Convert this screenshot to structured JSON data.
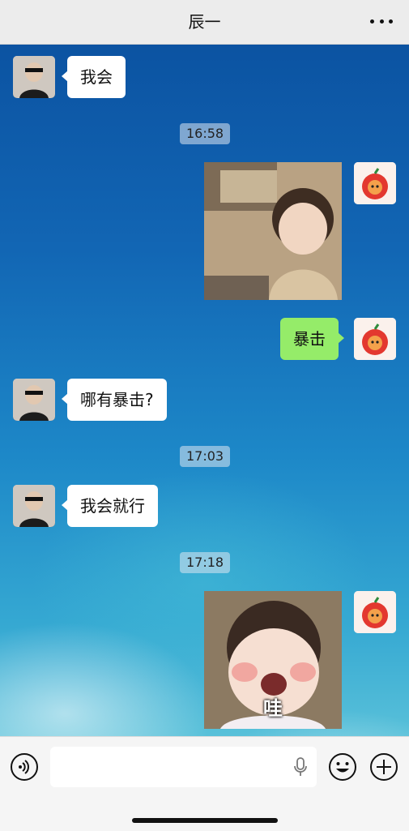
{
  "header": {
    "title": "辰一",
    "more_icon": "more-dots-icon"
  },
  "messages": [
    {
      "side": "left",
      "type": "text",
      "text": "我会"
    },
    {
      "type": "time",
      "text": "16:58"
    },
    {
      "side": "right",
      "type": "image",
      "description_icon": "photo"
    },
    {
      "side": "right",
      "type": "text",
      "text": "暴击"
    },
    {
      "side": "left",
      "type": "text",
      "text": "哪有暴击?"
    },
    {
      "type": "time",
      "text": "17:03"
    },
    {
      "side": "left",
      "type": "text",
      "text": "我会就行"
    },
    {
      "type": "time",
      "text": "17:18"
    },
    {
      "side": "right",
      "type": "image",
      "caption": "哇"
    }
  ],
  "input_bar": {
    "voice_icon": "voice-icon",
    "mic_icon": "microphone-icon",
    "emoji_icon": "emoji-icon",
    "plus_icon": "plus-icon",
    "input_value": ""
  },
  "colors": {
    "bubble_sent": "#95ec69",
    "bubble_received": "#ffffff",
    "header_bg": "#ececec"
  }
}
